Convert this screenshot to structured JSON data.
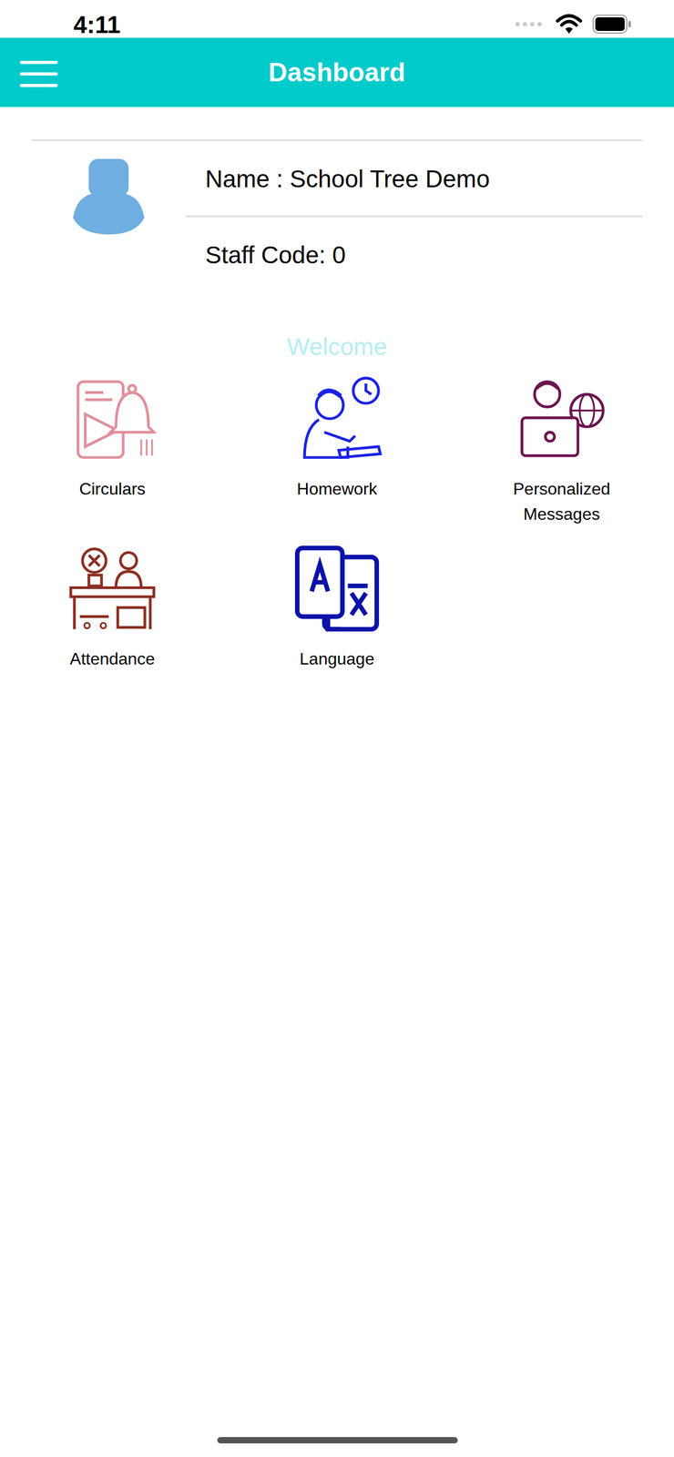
{
  "status_bar": {
    "time": "4:11"
  },
  "header": {
    "title": "Dashboard"
  },
  "profile": {
    "name": "Name : School Tree Demo",
    "staff_code": "Staff Code: 0"
  },
  "welcome": "Welcome",
  "tiles": [
    {
      "label": "Circulars",
      "color": "#e0909c"
    },
    {
      "label": "Homework",
      "color": "#1a22e6"
    },
    {
      "label": "Personalized Messages",
      "color": "#6b1450"
    },
    {
      "label": "Attendance",
      "color": "#8c2f22"
    },
    {
      "label": "Language",
      "color": "#0a12a8"
    }
  ]
}
